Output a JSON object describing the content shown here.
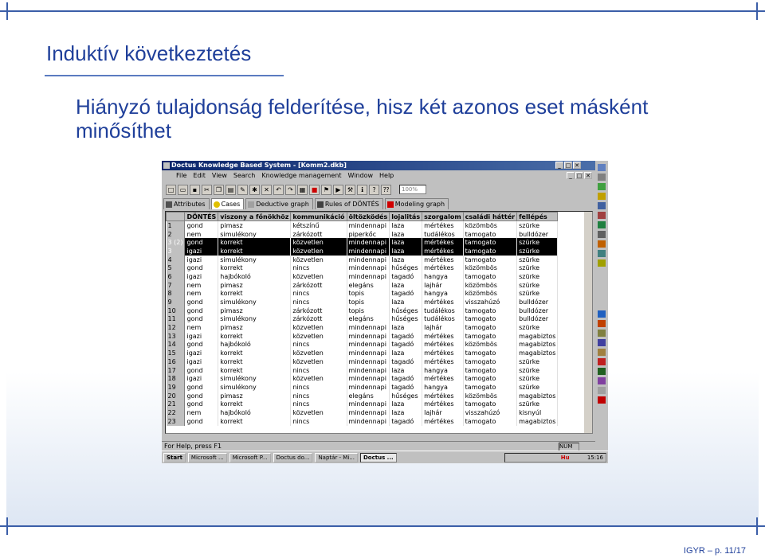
{
  "slide": {
    "title": "Induktív következtetés",
    "subtitle": "Hiányzó tulajdonság felderítése, hisz két azonos eset másként minősíthet",
    "footer": "IGYR – p. 11/17"
  },
  "window": {
    "title": "Doctus Knowledge Based System - [Komm2.dkb]",
    "controls": [
      "_",
      "□",
      "✕"
    ],
    "menu": [
      "File",
      "Edit",
      "View",
      "Search",
      "Knowledge management",
      "Window",
      "Help"
    ],
    "zoom": "100%",
    "tabs": [
      "Attributes",
      "Cases",
      "Deductive graph",
      "Rules of DÖNTÉS",
      "Modeling graph"
    ],
    "active_tab": "Cases",
    "columns": [
      "DÖNTÉS",
      "viszony a főnökhöz",
      "kommunikáció",
      "öltözködés",
      "lojalitás",
      "szorgalom",
      "családi háttér",
      "fellépés"
    ],
    "rows": [
      {
        "n": "1",
        "c": [
          "gond",
          "pimasz",
          "kétszínű",
          "mindennapi",
          "laza",
          "mértékes",
          "közömbös",
          "szürke"
        ]
      },
      {
        "n": "2",
        "c": [
          "nem",
          "simulékony",
          "zárkózott",
          "piperkőc",
          "laza",
          "tudálékos",
          "tamogato",
          "bulldózer"
        ]
      },
      {
        "n": "3 (2)",
        "c": [
          "gond",
          "korrekt",
          "közvetlen",
          "mindennapi",
          "laza",
          "mértékes",
          "tamogato",
          "szürke"
        ],
        "hl": true
      },
      {
        "n": "3",
        "c": [
          "igazi",
          "korrekt",
          "közvetlen",
          "mindennapi",
          "laza",
          "mértékes",
          "tamogato",
          "szürke"
        ],
        "hl": true
      },
      {
        "n": "4",
        "c": [
          "igazi",
          "simulékony",
          "közvetlen",
          "mindennapi",
          "laza",
          "mértékes",
          "tamogato",
          "szürke"
        ]
      },
      {
        "n": "5",
        "c": [
          "gond",
          "korrekt",
          "nincs",
          "mindennapi",
          "hűséges",
          "mértékes",
          "közömbös",
          "szürke"
        ]
      },
      {
        "n": "6",
        "c": [
          "igazi",
          "hajbókoló",
          "közvetlen",
          "mindennapi",
          "tagadó",
          "hangya",
          "tamogato",
          "szürke"
        ]
      },
      {
        "n": "7",
        "c": [
          "nem",
          "pimasz",
          "zárkózott",
          "elegáns",
          "laza",
          "lajhár",
          "közömbös",
          "szürke"
        ]
      },
      {
        "n": "8",
        "c": [
          "nem",
          "korrekt",
          "nincs",
          "topis",
          "tagadó",
          "hangya",
          "közömbös",
          "szürke"
        ]
      },
      {
        "n": "9",
        "c": [
          "gond",
          "simulékony",
          "nincs",
          "topis",
          "laza",
          "mértékes",
          "visszahúzó",
          "bulldózer"
        ]
      },
      {
        "n": "10",
        "c": [
          "gond",
          "pimasz",
          "zárkózott",
          "topis",
          "hűséges",
          "tudálékos",
          "tamogato",
          "bulldózer"
        ]
      },
      {
        "n": "11",
        "c": [
          "gond",
          "simulékony",
          "zárkózott",
          "elegáns",
          "hűséges",
          "tudálékos",
          "tamogato",
          "bulldózer"
        ]
      },
      {
        "n": "12",
        "c": [
          "nem",
          "pimasz",
          "közvetlen",
          "mindennapi",
          "laza",
          "lajhár",
          "tamogato",
          "szürke"
        ]
      },
      {
        "n": "13",
        "c": [
          "igazi",
          "korrekt",
          "közvetlen",
          "mindennapi",
          "tagadó",
          "mértékes",
          "tamogato",
          "magabiztos"
        ]
      },
      {
        "n": "14",
        "c": [
          "gond",
          "hajbókoló",
          "nincs",
          "mindennapi",
          "tagadó",
          "mértékes",
          "közömbös",
          "magabiztos"
        ]
      },
      {
        "n": "15",
        "c": [
          "igazi",
          "korrekt",
          "közvetlen",
          "mindennapi",
          "laza",
          "mértékes",
          "tamogato",
          "magabiztos"
        ]
      },
      {
        "n": "16",
        "c": [
          "igazi",
          "korrekt",
          "közvetlen",
          "mindennapi",
          "tagadó",
          "mértékes",
          "tamogato",
          "szürke"
        ]
      },
      {
        "n": "17",
        "c": [
          "gond",
          "korrekt",
          "nincs",
          "mindennapi",
          "laza",
          "hangya",
          "tamogato",
          "szürke"
        ]
      },
      {
        "n": "18",
        "c": [
          "igazi",
          "simulékony",
          "közvetlen",
          "mindennapi",
          "tagadó",
          "mértékes",
          "tamogato",
          "szürke"
        ]
      },
      {
        "n": "19",
        "c": [
          "gond",
          "simulékony",
          "nincs",
          "mindennapi",
          "tagadó",
          "hangya",
          "tamogato",
          "szürke"
        ]
      },
      {
        "n": "20",
        "c": [
          "gond",
          "pimasz",
          "nincs",
          "elegáns",
          "hűséges",
          "mértékes",
          "közömbös",
          "magabiztos"
        ]
      },
      {
        "n": "21",
        "c": [
          "gond",
          "korrekt",
          "nincs",
          "mindennapi",
          "laza",
          "mértékes",
          "tamogato",
          "szürke"
        ]
      },
      {
        "n": "22",
        "c": [
          "nem",
          "hajbókoló",
          "közvetlen",
          "mindennapi",
          "laza",
          "lajhár",
          "visszahúzó",
          "kisnyúl"
        ]
      },
      {
        "n": "23",
        "c": [
          "gond",
          "korrekt",
          "nincs",
          "mindennapi",
          "tagadó",
          "mértékes",
          "tamogato",
          "magabiztos"
        ]
      }
    ],
    "status_left": "For Help, press F1",
    "status_num": "NUM",
    "taskbar": [
      "Start",
      "Microsoft ...",
      "Microsoft P...",
      "Doctus do...",
      "Naptár - Mi...",
      "Doctus ..."
    ],
    "clock": "15:16",
    "tray_labels": [
      "Hu"
    ]
  },
  "colors": {
    "title_blue": "#1f3f9a",
    "frame_blue": "#3b5ea8",
    "titlebar_dark": "#0a246a",
    "highlight_row": "#000000"
  }
}
